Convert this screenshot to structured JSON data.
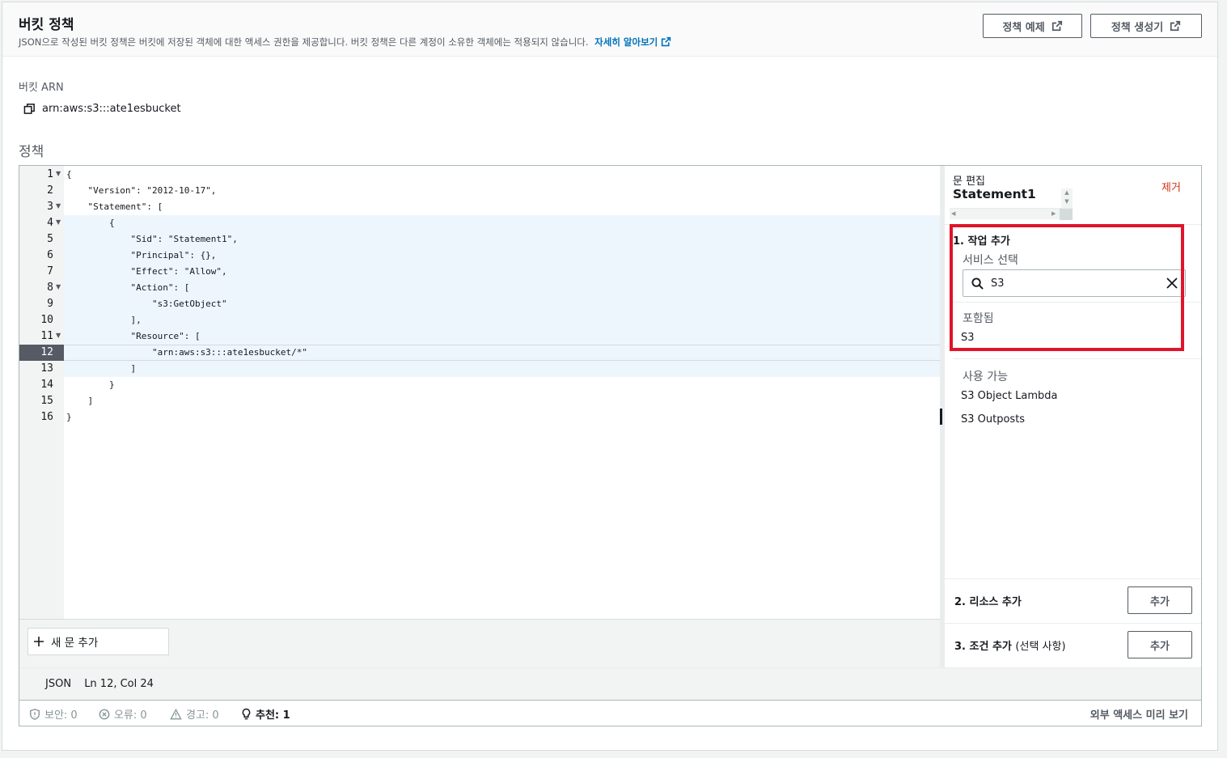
{
  "header": {
    "title": "버킷 정책",
    "description": "JSON으로 작성된 버킷 정책은 버킷에 저장된 객체에 대한 액세스 권한을 제공합니다. 버킷 정책은 다른 계정이 소유한 객체에는 적용되지 않습니다.",
    "learn_more": "자세히 알아보기",
    "examples_button": "정책 예제",
    "generator_button": "정책 생성기"
  },
  "bucket_arn": {
    "label": "버킷 ARN",
    "value": "arn:aws:s3:::ate1esbucket"
  },
  "policy": {
    "label": "정책",
    "lines": [
      {
        "num": "1",
        "code": "{"
      },
      {
        "num": "2",
        "code": "    \"Version\": \"2012-10-17\","
      },
      {
        "num": "3",
        "code": "    \"Statement\": ["
      },
      {
        "num": "4",
        "code": "        {"
      },
      {
        "num": "5",
        "code": "            \"Sid\": \"Statement1\","
      },
      {
        "num": "6",
        "code": "            \"Principal\": {},"
      },
      {
        "num": "7",
        "code": "            \"Effect\": \"Allow\","
      },
      {
        "num": "8",
        "code": "            \"Action\": ["
      },
      {
        "num": "9",
        "code": "                \"s3:GetObject\""
      },
      {
        "num": "10",
        "code": "            ],"
      },
      {
        "num": "11",
        "code": "            \"Resource\": ["
      },
      {
        "num": "12",
        "code": "                \"arn:aws:s3:::ate1esbucket/*\""
      },
      {
        "num": "13",
        "code": "            ]"
      },
      {
        "num": "14",
        "code": "        }"
      },
      {
        "num": "15",
        "code": "    ]"
      },
      {
        "num": "16",
        "code": "}"
      }
    ],
    "add_statement": "새 문 추가"
  },
  "status": {
    "language": "JSON",
    "cursor": "Ln 12, Col 24"
  },
  "issues": {
    "security": "보안: 0",
    "errors": "오류: 0",
    "warnings": "경고: 0",
    "suggestions": "추천: 1",
    "external_access_preview": "외부 액세스 미리 보기"
  },
  "side_panel": {
    "edit_label": "문 편집",
    "statement_name": "Statement1",
    "remove": "제거",
    "step1": "1. 작업 추가",
    "service_select_label": "서비스 선택",
    "search_value": "S3",
    "included_label": "포함됨",
    "included_items": [
      "S3"
    ],
    "available_label": "사용 가능",
    "available_items": [
      "S3 Object Lambda",
      "S3 Outposts"
    ],
    "step2": "2. 리소스 추가",
    "step3": "3. 조건 추가",
    "step3_optional": "(선택 사항)",
    "add_button": "추가"
  },
  "colors": {
    "accent_link": "#0073bb",
    "remove_red": "#d13212",
    "highlight_box": "#e0142a"
  }
}
